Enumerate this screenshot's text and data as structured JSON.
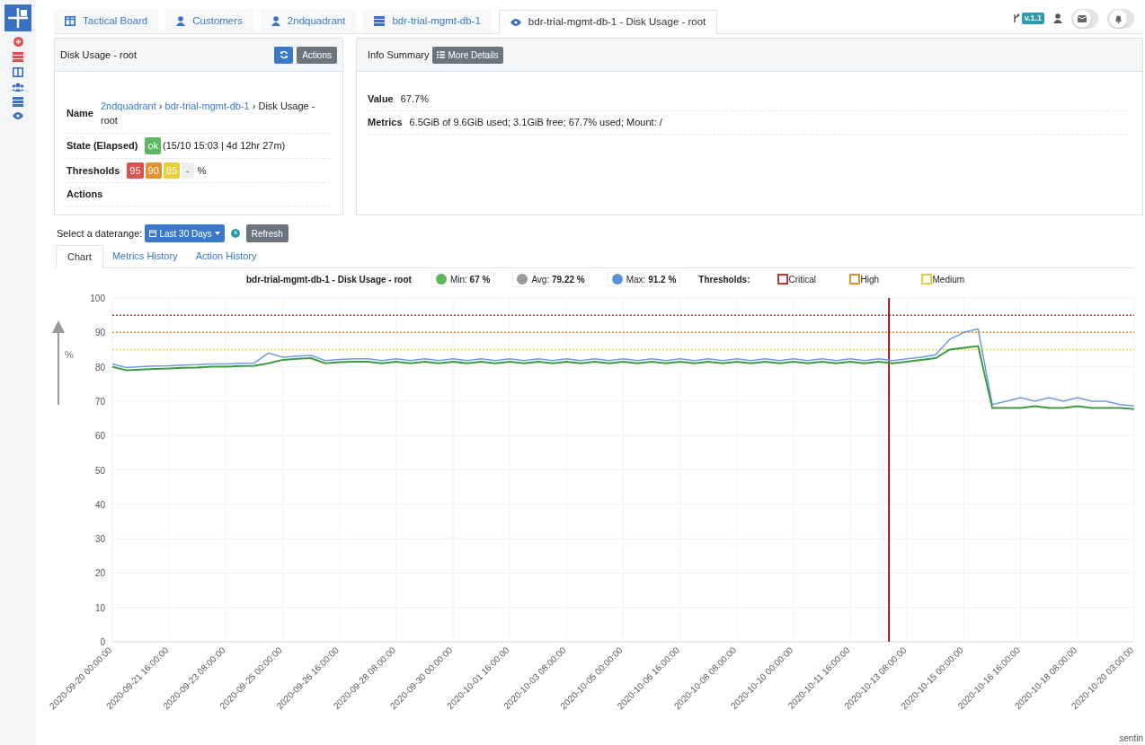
{
  "tabs": [
    {
      "label": "Tactical Board",
      "kind": "board",
      "selected": false
    },
    {
      "label": "Customers",
      "kind": "person",
      "selected": false
    },
    {
      "label": "2ndquadrant",
      "kind": "person",
      "selected": false
    },
    {
      "label": "bdr-trial-mgmt-db-1",
      "kind": "server",
      "selected": false
    },
    {
      "label": "bdr-trial-mgmt-db-1 - Disk Usage - root",
      "kind": "eye",
      "selected": true
    }
  ],
  "topbar": {
    "version": "v.1.1"
  },
  "check_panel": {
    "title": "Disk Usage - root",
    "actions_button": "Actions",
    "name_label": "Name",
    "breadcrumb": [
      {
        "text": "2ndquadrant",
        "kind": "link"
      },
      {
        "text": "›",
        "kind": "separator"
      },
      {
        "text": "bdr-trial-mgmt-db-1",
        "kind": "link"
      },
      {
        "text": "›",
        "kind": "separator"
      },
      {
        "text": "Disk Usage - root",
        "kind": "current"
      }
    ],
    "state_label": "State (Elapsed)",
    "state": "ok",
    "elapsed": "(15/10 15:03 | 4d 12hr 27m)",
    "thresholds_label": "Thresholds",
    "thresholds": [
      {
        "value": "95",
        "color": "#d9534f"
      },
      {
        "value": "90",
        "color": "#e0922f"
      },
      {
        "value": "85",
        "color": "#e6cf3a"
      },
      {
        "value": "-",
        "color": "#eeeeee"
      }
    ],
    "thresholds_unit": "%",
    "actions_label": "Actions"
  },
  "info_panel": {
    "title": "Info Summary",
    "more_button": "More Details",
    "rows": [
      {
        "label": "Value",
        "value": "67.7%"
      },
      {
        "label": "Metrics",
        "value": "6.5GiB of 9.6GiB used; 3.1GiB free; 67.7% used; Mount: /"
      }
    ]
  },
  "daterange": {
    "label": "Select a daterange:",
    "value": "Last 30 Days",
    "refresh": "Refresh"
  },
  "view_tabs": [
    {
      "label": "Chart",
      "selected": true
    },
    {
      "label": "Metrics History",
      "selected": false
    },
    {
      "label": "Action History",
      "selected": false
    }
  ],
  "chart_header": {
    "title": "bdr-trial-mgmt-db-1 - Disk Usage - root",
    "stats": [
      {
        "label": "Min:",
        "value": "67 %",
        "color": "#5cb85c"
      },
      {
        "label": "Avg:",
        "value": "79.22 %",
        "color": "#999999"
      },
      {
        "label": "Max:",
        "value": "91.2 %",
        "color": "#5b8fd6"
      }
    ],
    "thresholds_label": "Thresholds:",
    "thresholds": [
      {
        "label": "Critical",
        "color": "#c0392b"
      },
      {
        "label": "High",
        "color": "#e0922f"
      },
      {
        "label": "Medium",
        "color": "#e6cf3a"
      }
    ]
  },
  "chart_data": {
    "type": "line",
    "ylabel": "%",
    "ylim": [
      0,
      100
    ],
    "grid": true,
    "yticks": [
      0,
      10,
      20,
      30,
      40,
      50,
      60,
      70,
      80,
      90,
      100
    ],
    "categories": [
      "2020-09-20 00:00:00",
      null,
      null,
      null,
      "2020-09-21 16:00:00",
      null,
      null,
      null,
      "2020-09-23 08:00:00",
      null,
      null,
      null,
      "2020-09-25 00:00:00",
      null,
      null,
      null,
      "2020-09-26 16:00:00",
      null,
      null,
      null,
      "2020-09-28 08:00:00",
      null,
      null,
      null,
      "2020-09-30 00:00:00",
      null,
      null,
      null,
      "2020-10-01 16:00:00",
      null,
      null,
      null,
      "2020-10-03 08:00:00",
      null,
      null,
      null,
      "2020-10-05 00:00:00",
      null,
      null,
      null,
      "2020-10-06 16:00:00",
      null,
      null,
      null,
      "2020-10-08 08:00:00",
      null,
      null,
      null,
      "2020-10-10 00:00:00",
      null,
      null,
      null,
      "2020-10-11 16:00:00",
      null,
      null,
      null,
      "2020-10-13 08:00:00",
      null,
      null,
      null,
      "2020-10-15 00:00:00",
      null,
      null,
      null,
      "2020-10-16 16:00:00",
      null,
      null,
      null,
      "2020-10-18 08:00:00",
      null,
      null,
      null,
      "2020-10-20 03:00:00"
    ],
    "series": [
      {
        "color": "#6f9be0",
        "values": [
          80.8,
          79.8,
          80,
          80.2,
          80.3,
          80.5,
          80.6,
          80.8,
          80.8,
          81,
          81.1,
          84,
          82.8,
          83.1,
          83.3,
          81.8,
          82.1,
          82.3,
          82.3,
          81.8,
          82.3,
          81.8,
          82.3,
          81.8,
          82.3,
          81.8,
          82.3,
          81.8,
          82.3,
          81.8,
          82.3,
          81.8,
          82.3,
          81.8,
          82.3,
          81.8,
          82.3,
          81.8,
          82.3,
          81.8,
          82.3,
          81.8,
          82.3,
          81.8,
          82.3,
          81.8,
          82.3,
          81.8,
          82.3,
          81.8,
          82.3,
          81.8,
          82.3,
          81.8,
          82.3,
          81.8,
          82.3,
          82.8,
          83.5,
          88,
          90,
          91,
          69,
          70,
          71,
          70,
          71,
          70,
          71,
          70,
          70,
          69,
          68.6
        ]
      },
      {
        "color": "#3f9a3f",
        "values": [
          80,
          79,
          79.2,
          79.4,
          79.5,
          79.7,
          79.8,
          80,
          80,
          80.2,
          80.3,
          81,
          82,
          82.3,
          82.5,
          81,
          81.3,
          81.5,
          81.5,
          81,
          81.5,
          81,
          81.5,
          81,
          81.5,
          81,
          81.5,
          81,
          81.5,
          81,
          81.5,
          81,
          81.5,
          81,
          81.5,
          81,
          81.5,
          81,
          81.5,
          81,
          81.5,
          81,
          81.5,
          81,
          81.5,
          81,
          81.5,
          81,
          81.5,
          81,
          81.5,
          81,
          81.5,
          81,
          81.5,
          81,
          81.5,
          82,
          82.5,
          85,
          85.5,
          86,
          68,
          68,
          68,
          68.5,
          68,
          68,
          68.5,
          68,
          68,
          68,
          67.7
        ]
      }
    ],
    "ref_lines": [
      {
        "axis": "y",
        "value": 95,
        "color": "#c0392b"
      },
      {
        "axis": "y",
        "value": 90,
        "color": "#e0922f"
      },
      {
        "axis": "y",
        "value": 85,
        "color": "#e6cf3a"
      }
    ]
  },
  "footer": {
    "text": "sentin"
  }
}
